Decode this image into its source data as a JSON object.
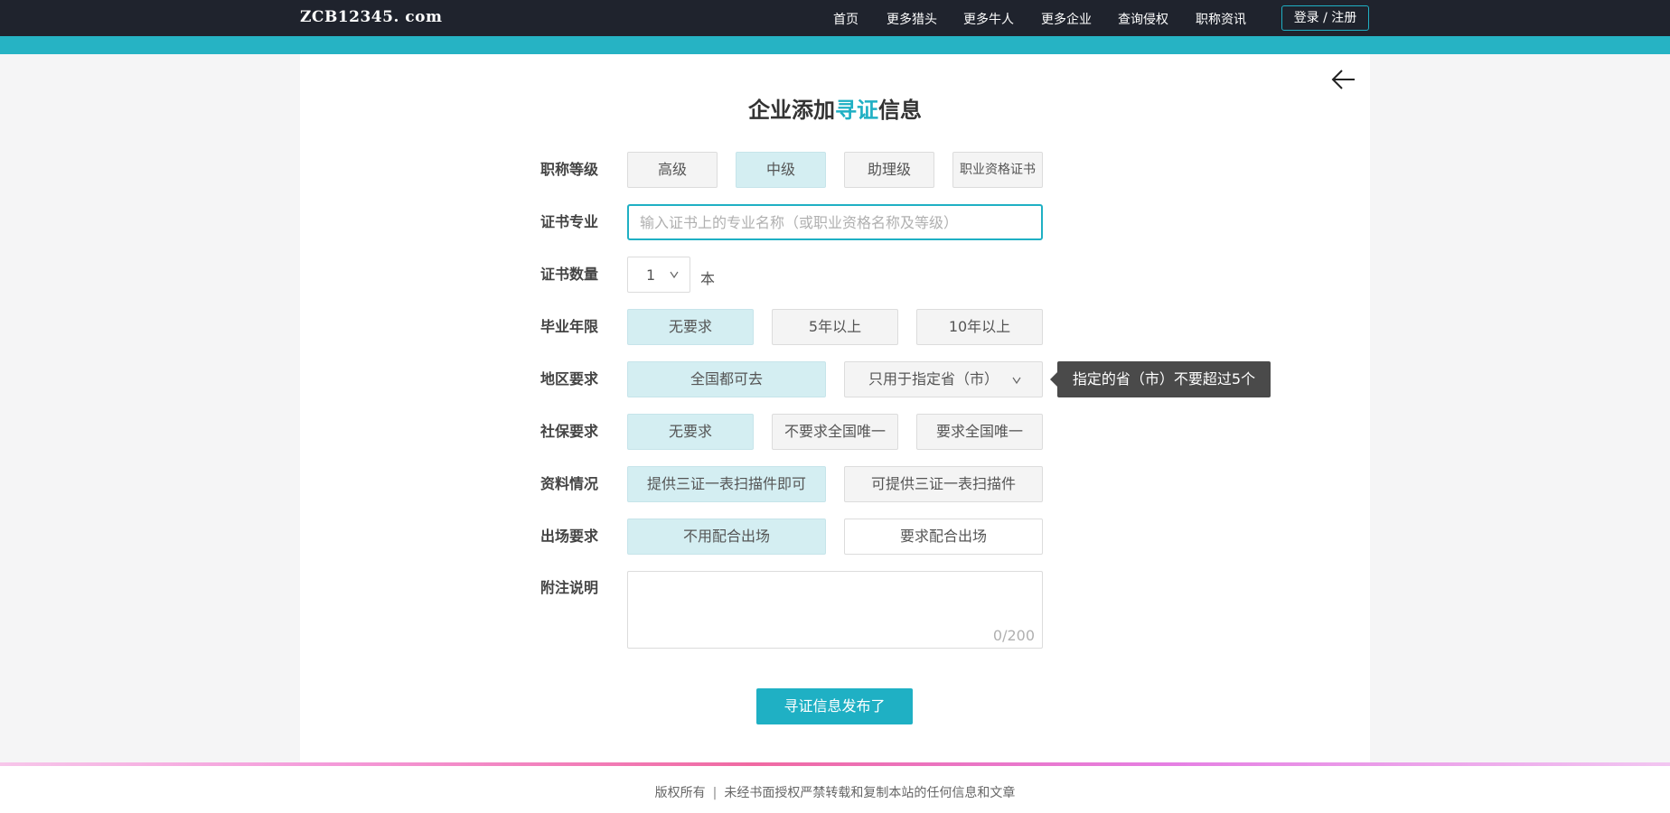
{
  "header": {
    "logo": "ZCB12345. com",
    "nav": [
      "首页",
      "更多猎头",
      "更多牛人",
      "更多企业",
      "查询侵权",
      "职称资讯"
    ],
    "login": "登录 / 注册"
  },
  "page": {
    "title_pre": "企业添加",
    "title_hl": "寻证",
    "title_post": "信息"
  },
  "form": {
    "level": {
      "label": "职称等级",
      "options": [
        "高级",
        "中级",
        "助理级",
        "职业资格证书"
      ],
      "selected": "中级"
    },
    "specialty": {
      "label": "证书专业",
      "placeholder": "输入证书上的专业名称（或职业资格名称及等级）",
      "value": ""
    },
    "quantity": {
      "label": "证书数量",
      "value": "1",
      "unit": "本"
    },
    "graduation": {
      "label": "毕业年限",
      "options": [
        "无要求",
        "5年以上",
        "10年以上"
      ],
      "selected": "无要求"
    },
    "region": {
      "label": "地区要求",
      "options": [
        "全国都可去",
        "只用于指定省（市）"
      ],
      "selected": "全国都可去",
      "tooltip": "指定的省（市）不要超过5个"
    },
    "social": {
      "label": "社保要求",
      "options": [
        "无要求",
        "不要求全国唯一",
        "要求全国唯一"
      ],
      "selected": "无要求"
    },
    "materials": {
      "label": "资料情况",
      "options": [
        "提供三证一表扫描件即可",
        "可提供三证一表扫描件"
      ],
      "selected": "提供三证一表扫描件即可"
    },
    "appearance": {
      "label": "出场要求",
      "options": [
        "不用配合出场",
        "要求配合出场"
      ],
      "selected": "不用配合出场"
    },
    "notes": {
      "label": "附注说明",
      "counter": "0/200"
    },
    "submit": "寻证信息发布了"
  },
  "footer": {
    "left": "版权所有",
    "sep": "|",
    "right": "未经书面授权严禁转载和复制本站的任何信息和文章"
  },
  "colors": {
    "accent": "#1fb0c4",
    "header_bg": "#1f232d",
    "selected_bg": "#d4eef2"
  }
}
